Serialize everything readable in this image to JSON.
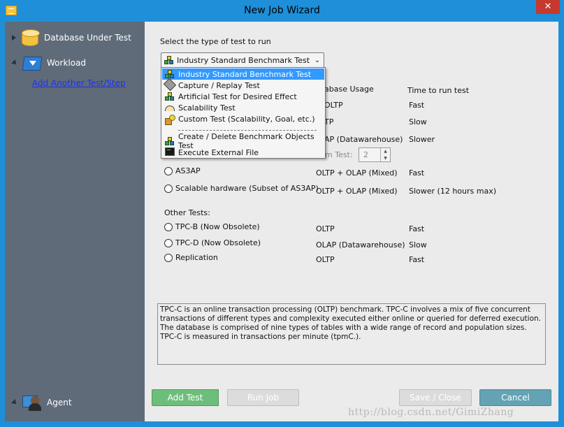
{
  "window": {
    "title": "New Job Wizard",
    "close_glyph": "✕"
  },
  "sidebar": {
    "items": [
      {
        "label": "Database Under Test",
        "icon": "database-icon",
        "expanded": false
      },
      {
        "label": "Workload",
        "icon": "workload-icon",
        "expanded": true
      },
      {
        "label": "Agent",
        "icon": "agent-icon",
        "expanded": true
      }
    ],
    "add_link": "Add Another Test/Step"
  },
  "main": {
    "prompt": "Select the type of test to run",
    "combo": {
      "selected": "Industry Standard Benchmark Test",
      "arrow_glyph": "⌄"
    },
    "columns": {
      "usage_partial": "abase Usage",
      "time": "Time to run test"
    },
    "partial_rows": [
      {
        "usage": "OLTP",
        "time": "Fast"
      },
      {
        "usage": "TP",
        "time": "Slow"
      },
      {
        "usage": "AP (Datawarehouse)",
        "time": "Slower"
      }
    ],
    "scale_label_partial": "m Test:",
    "scale_value": "2",
    "spin_up_glyph": "▲",
    "spin_down_glyph": "▼",
    "benchmarks": [
      {
        "label": "AS3AP",
        "usage": "OLTP + OLAP (Mixed)",
        "time": "Fast"
      },
      {
        "label": "Scalable hardware (Subset of AS3AP)",
        "usage": "OLTP + OLAP (Mixed)",
        "time": "Slower (12 hours max)"
      }
    ],
    "other_heading": "Other Tests:",
    "other_tests": [
      {
        "label": "TPC-B (Now Obsolete)",
        "usage": "OLTP",
        "time": "Fast"
      },
      {
        "label": "TPC-D (Now Obsolete)",
        "usage": "OLAP (Datawarehouse)",
        "time": "Slow"
      },
      {
        "label": "Replication",
        "usage": "OLTP",
        "time": "Fast"
      }
    ],
    "description": "TPC-C is an online transaction processing (OLTP) benchmark.  TPC-C involves a mix of five concurrent transactions of different types and complexity executed either online or queried for deferred execution.  The database is comprised of nine types of tables with a wide range of record and population sizes.  TPC-C is measured in transactions per minute (tpmC.).",
    "buttons": {
      "add_test": "Add Test",
      "run_job": "Run Job",
      "save_close": "Save / Close",
      "cancel": "Cancel"
    }
  },
  "dropdown": {
    "items": [
      {
        "label": "Industry Standard Benchmark Test",
        "icon": "benchmark-cubes-icon"
      },
      {
        "label": "Capture / Replay Test",
        "icon": "camera-icon"
      },
      {
        "label": "Artificial Test for Desired Effect",
        "icon": "artificial-cubes-icon"
      },
      {
        "label": "Scalability Test",
        "icon": "gauge-icon"
      },
      {
        "label": "Custom Test (Scalability, Goal, etc.)",
        "icon": "custom-tools-icon"
      },
      {
        "label": "Create / Delete Benchmark Objects Test",
        "icon": "create-cubes-icon"
      },
      {
        "label": "Execute External File",
        "icon": "terminal-icon"
      }
    ],
    "selected_index": 0
  },
  "watermark": "http://blog.csdn.net/GimiZhang",
  "colors": {
    "titlebar": "#1e8fd8",
    "sidebar": "#5f6b79",
    "selection": "#3399ff",
    "add_button": "#6dbe7a",
    "cancel_button": "#63a3b3",
    "link": "#1a30ff"
  }
}
